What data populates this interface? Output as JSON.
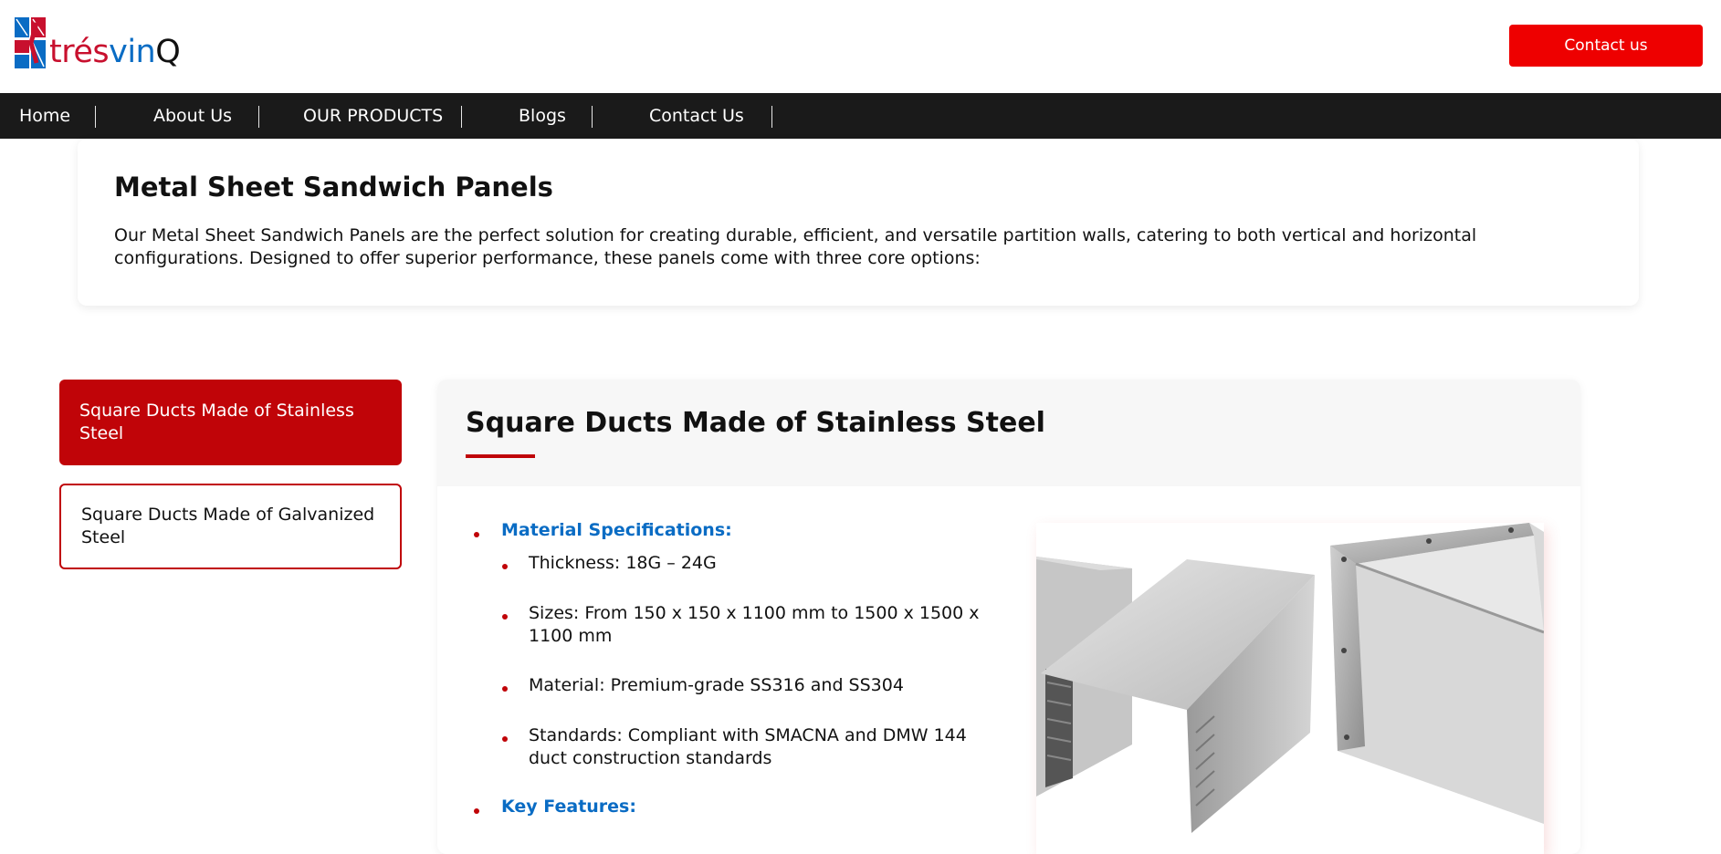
{
  "header": {
    "logo": {
      "brand_part1": "trés",
      "brand_part2": "vin",
      "brand_part3": "Q"
    },
    "contact_button": "Contact us"
  },
  "nav": {
    "items": [
      {
        "label": "Home"
      },
      {
        "label": "About Us"
      },
      {
        "label": "OUR PRODUCTS"
      },
      {
        "label": "Blogs"
      },
      {
        "label": "Contact Us"
      }
    ]
  },
  "intro": {
    "title": "Metal Sheet Sandwich Panels",
    "text": "Our Metal Sheet Sandwich Panels are the perfect solution for creating durable, efficient, and versatile partition walls, catering to both vertical and horizontal configurations. Designed to offer superior performance, these panels come with three core options:"
  },
  "sidebar": {
    "tabs": [
      {
        "label": "Square Ducts Made of Stainless Steel",
        "active": true
      },
      {
        "label": "Square Ducts Made of Galvanized Steel",
        "active": false
      }
    ]
  },
  "content": {
    "title": "Square Ducts Made of Stainless Steel",
    "sections": [
      {
        "heading": "Material Specifications:",
        "items": [
          "Thickness: 18G – 24G",
          "Sizes: From 150 x 150 x 1100 mm to 1500 x 1500 x 1100 mm",
          "Material: Premium-grade SS316 and SS304",
          "Standards: Compliant with SMACNA and DMW 144 duct construction standards"
        ]
      },
      {
        "heading": "Key Features:",
        "items": []
      }
    ]
  },
  "colors": {
    "accent_red": "#c00408",
    "button_red": "#ee0000",
    "nav_bg": "#1a1a1a",
    "link_blue": "#0a6cc4"
  }
}
